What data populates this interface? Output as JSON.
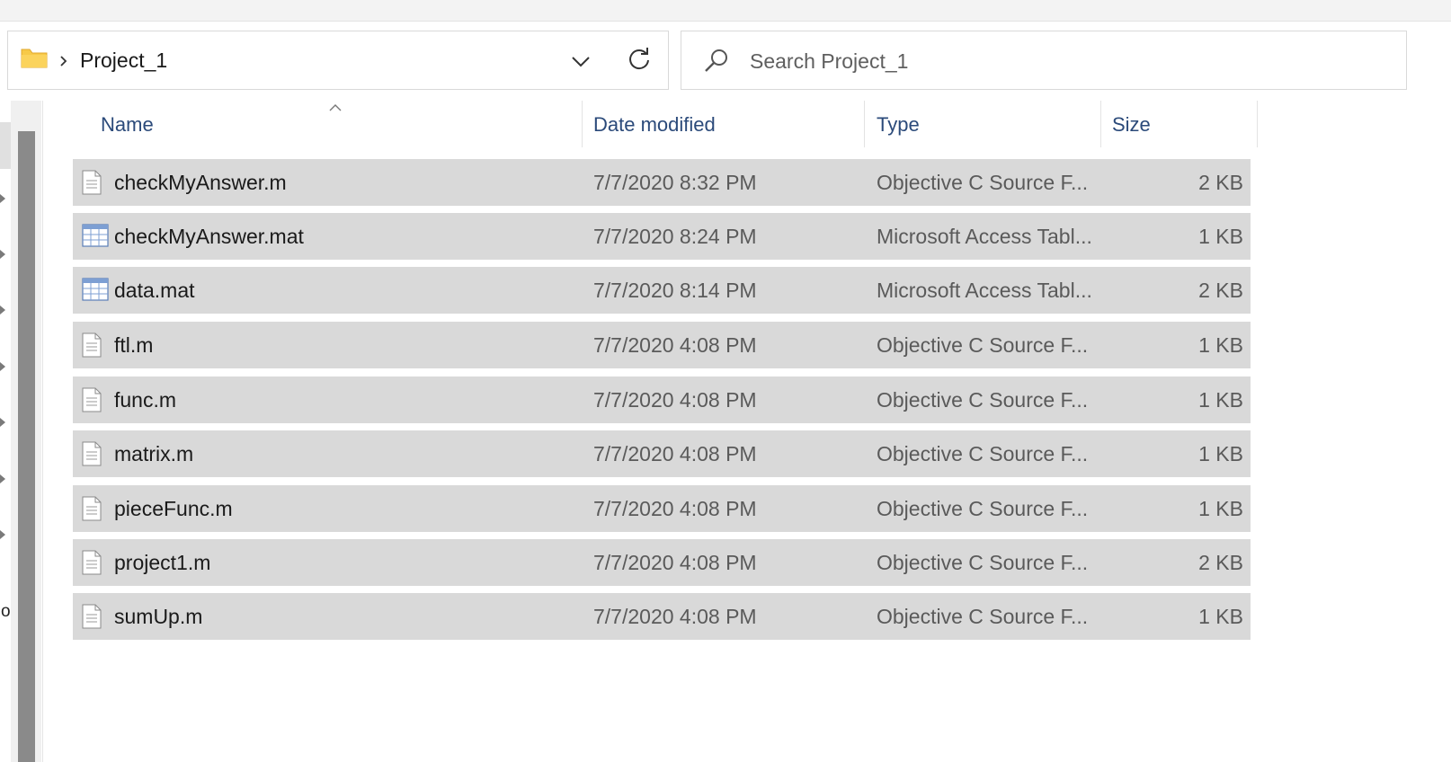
{
  "address_bar": {
    "breadcrumb": "Project_1",
    "folder_icon": "folder-icon",
    "separator_icon": "chevron-right-icon",
    "dropdown_icon": "chevron-down-icon",
    "refresh_icon": "refresh-icon"
  },
  "search": {
    "placeholder": "Search Project_1",
    "icon": "search-icon"
  },
  "columns": {
    "name": "Name",
    "date": "Date modified",
    "type": "Type",
    "size": "Size",
    "sort_icon": "sort-ascending-icon"
  },
  "nav_pane": {
    "visible_letter": "o"
  },
  "files": [
    {
      "name": "checkMyAnswer.m",
      "date": "7/7/2020 8:32 PM",
      "type": "Objective C Source F...",
      "size": "2 KB",
      "icon": "text-file-icon"
    },
    {
      "name": "checkMyAnswer.mat",
      "date": "7/7/2020 8:24 PM",
      "type": "Microsoft Access Tabl...",
      "size": "1 KB",
      "icon": "table-file-icon"
    },
    {
      "name": "data.mat",
      "date": "7/7/2020 8:14 PM",
      "type": "Microsoft Access Tabl...",
      "size": "2 KB",
      "icon": "table-file-icon"
    },
    {
      "name": "ftl.m",
      "date": "7/7/2020 4:08 PM",
      "type": "Objective C Source F...",
      "size": "1 KB",
      "icon": "text-file-icon"
    },
    {
      "name": "func.m",
      "date": "7/7/2020 4:08 PM",
      "type": "Objective C Source F...",
      "size": "1 KB",
      "icon": "text-file-icon"
    },
    {
      "name": "matrix.m",
      "date": "7/7/2020 4:08 PM",
      "type": "Objective C Source F...",
      "size": "1 KB",
      "icon": "text-file-icon"
    },
    {
      "name": "pieceFunc.m",
      "date": "7/7/2020 4:08 PM",
      "type": "Objective C Source F...",
      "size": "1 KB",
      "icon": "text-file-icon"
    },
    {
      "name": "project1.m",
      "date": "7/7/2020 4:08 PM",
      "type": "Objective C Source F...",
      "size": "2 KB",
      "icon": "text-file-icon"
    },
    {
      "name": "sumUp.m",
      "date": "7/7/2020 4:08 PM",
      "type": "Objective C Source F...",
      "size": "1 KB",
      "icon": "text-file-icon"
    }
  ],
  "colors": {
    "selected_row": "#d9d9d9",
    "header_text": "#2b4a7a",
    "folder": "#f7c948"
  }
}
